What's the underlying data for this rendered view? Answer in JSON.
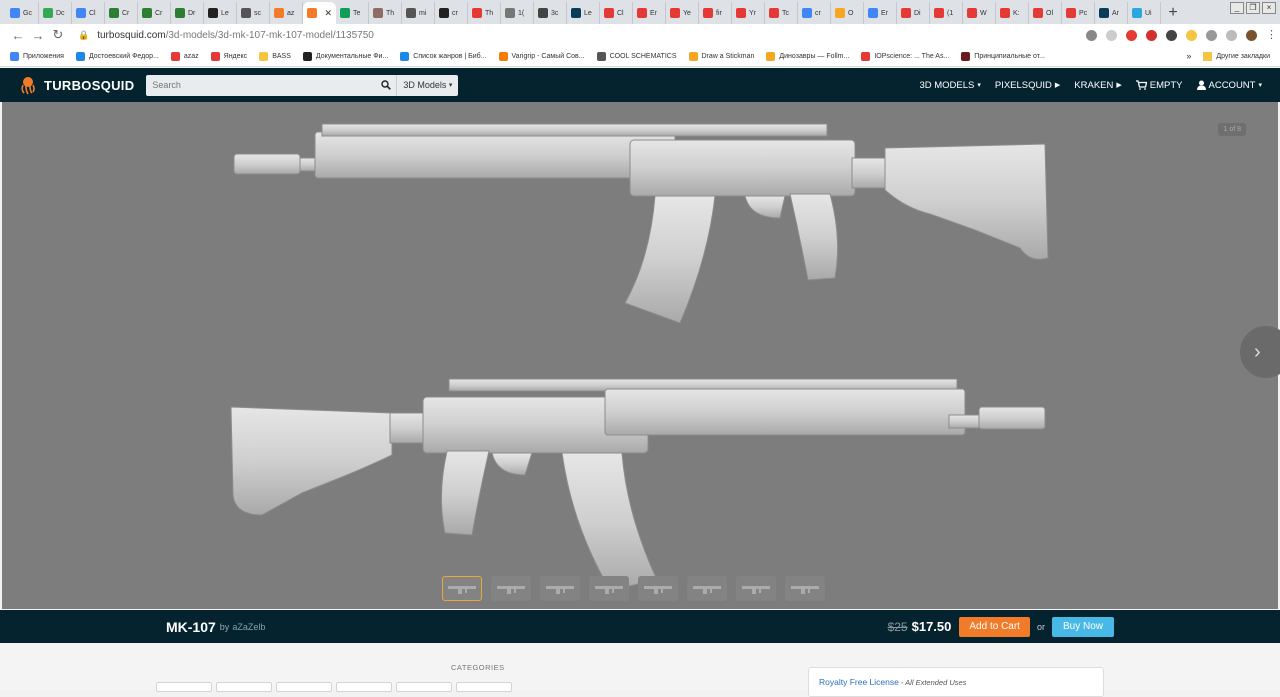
{
  "browser": {
    "tabs": [
      {
        "label": "Gc",
        "color": "#4285f4"
      },
      {
        "label": "Dc",
        "color": "#34a853"
      },
      {
        "label": "Cl",
        "color": "#4285f4"
      },
      {
        "label": "Cr",
        "color": "#2e7d32"
      },
      {
        "label": "Cr",
        "color": "#2e7d32"
      },
      {
        "label": "Dr",
        "color": "#2e7d32"
      },
      {
        "label": "Le",
        "color": "#222222"
      },
      {
        "label": "sc",
        "color": "#555555"
      },
      {
        "label": "az",
        "color": "#f27b29"
      },
      {
        "label": "",
        "color": "#f27b29"
      },
      {
        "label": "Te",
        "color": "#0f9d58"
      },
      {
        "label": "Th",
        "color": "#8d6e63"
      },
      {
        "label": "mi",
        "color": "#555555"
      },
      {
        "label": "cr",
        "color": "#222222"
      },
      {
        "label": "Th",
        "color": "#e53935"
      },
      {
        "label": "1(",
        "color": "#777777"
      },
      {
        "label": "3c",
        "color": "#444444"
      },
      {
        "label": "Le",
        "color": "#0b3d59"
      },
      {
        "label": "Cl",
        "color": "#e53935"
      },
      {
        "label": "Er",
        "color": "#e53935"
      },
      {
        "label": "Ye",
        "color": "#e53935"
      },
      {
        "label": "fir",
        "color": "#e53935"
      },
      {
        "label": "Yr",
        "color": "#e53935"
      },
      {
        "label": "Tc",
        "color": "#e53935"
      },
      {
        "label": "cr",
        "color": "#4285f4"
      },
      {
        "label": "O",
        "color": "#f5a623"
      },
      {
        "label": "Er",
        "color": "#4285f4"
      },
      {
        "label": "Di",
        "color": "#e53935"
      },
      {
        "label": "(1",
        "color": "#e53935"
      },
      {
        "label": "W",
        "color": "#e53935"
      },
      {
        "label": "K:",
        "color": "#e53935"
      },
      {
        "label": "Ol",
        "color": "#e53935"
      },
      {
        "label": "Pc",
        "color": "#e53935"
      },
      {
        "label": "Ar",
        "color": "#0b3d59"
      },
      {
        "label": "Ui",
        "color": "#29a8e0"
      }
    ],
    "active_tab_index": 9,
    "url_domain": "turbosquid.com",
    "url_path": "/3d-models/3d-mk-107-mk-107-model/1135750",
    "bookmarks": [
      {
        "label": "Приложения",
        "color": "#4285f4"
      },
      {
        "label": "Достоевский Федор...",
        "color": "#1e88e5"
      },
      {
        "label": "azaz",
        "color": "#e53935"
      },
      {
        "label": "Яндекс",
        "color": "#e53935"
      },
      {
        "label": "BASS",
        "color": "#f5c542"
      },
      {
        "label": "Документальные Фи...",
        "color": "#222222"
      },
      {
        "label": "Список жанров | Биб...",
        "color": "#1e88e5"
      },
      {
        "label": "Varigrip - Самый Сов...",
        "color": "#f57c00"
      },
      {
        "label": "COOL SCHEMATICS",
        "color": "#555555"
      },
      {
        "label": "Draw a Stickman",
        "color": "#f5a623"
      },
      {
        "label": "Динозавры — Follm...",
        "color": "#f5a623"
      },
      {
        "label": "IOPscience: ... The As...",
        "color": "#e53935"
      },
      {
        "label": "Принципиальные от...",
        "color": "#6a1b1b"
      }
    ],
    "bookmarks_more": "»",
    "other_bookmarks": "Другие закладки"
  },
  "header": {
    "logo": "TURBOSQUID",
    "search_placeholder": "Search",
    "search_category": "3D Models",
    "nav": {
      "models": "3D MODELS",
      "pixelsquid": "PIXELSQUID",
      "kraken": "KRAKEN",
      "cart": "EMPTY",
      "account": "ACCOUNT"
    }
  },
  "viewer": {
    "counter": "1 of 8",
    "thumbnail_count": 8,
    "active_thumbnail": 0
  },
  "product": {
    "title": "MK-107",
    "by": "by",
    "author": "aZaZelb",
    "old_price": "$25",
    "price": "$17.50",
    "add_to_cart": "Add to Cart",
    "or": "or",
    "buy_now": "Buy Now"
  },
  "lower": {
    "categories_heading": "CATEGORIES",
    "license_link": "Royalty Free License",
    "license_note": "- All Extended Uses"
  },
  "colors": {
    "site_header": "#05232e",
    "viewer_bg": "#7d7d7d",
    "cart_button": "#f27b29",
    "buy_button": "#48b9e6",
    "active_thumb_border": "#e8a83a"
  }
}
